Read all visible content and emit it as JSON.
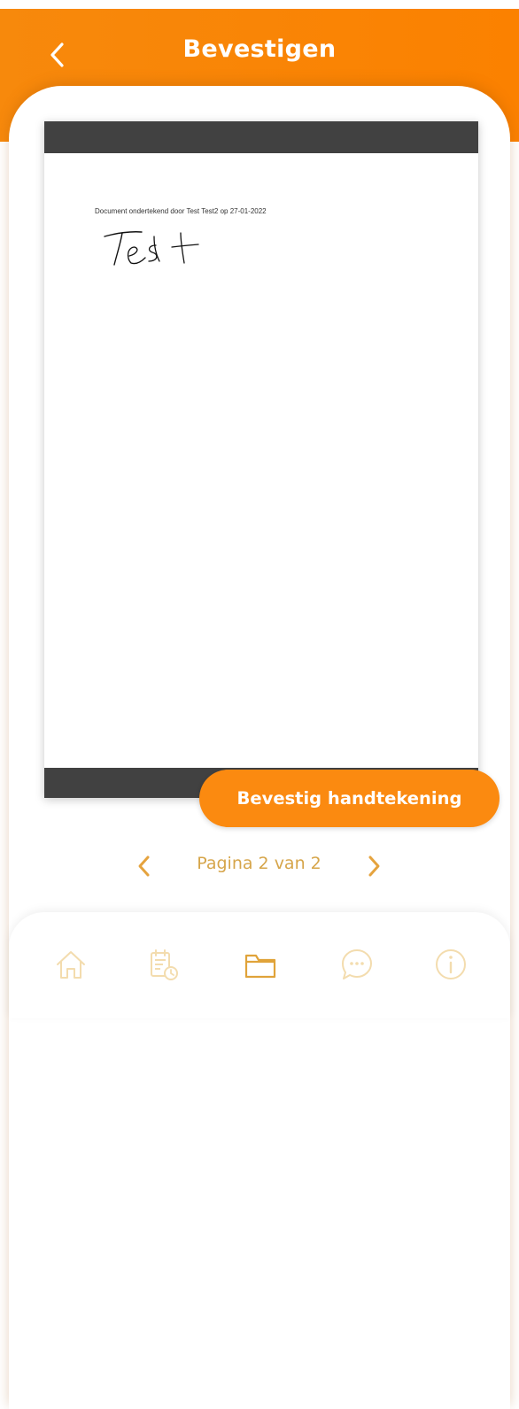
{
  "header": {
    "title": "Bevestigen",
    "back_icon": "chevron-left-icon"
  },
  "document": {
    "caption": "Document ondertekend door Test Test2 op 27-01-2022",
    "signature_text": "Test"
  },
  "actions": {
    "confirm_label": "Bevestig handtekening"
  },
  "pagination": {
    "label": "Pagina 2 van 2",
    "current_page": 2,
    "total_pages": 2,
    "prev_icon": "chevron-left-icon",
    "next_icon": "chevron-right-icon"
  },
  "bottom_nav": {
    "items": [
      {
        "icon": "home-icon",
        "active": false
      },
      {
        "icon": "calendar-clock-icon",
        "active": false
      },
      {
        "icon": "folder-icon",
        "active": true
      },
      {
        "icon": "chat-icon",
        "active": false
      },
      {
        "icon": "info-icon",
        "active": false
      }
    ]
  },
  "colors": {
    "accent": "#fb8500",
    "button": "#fb8a10",
    "pager_text": "#d6a54a",
    "nav_active": "#e0a33a",
    "nav_inactive": "#f3dcae",
    "doc_bar": "#414141"
  }
}
